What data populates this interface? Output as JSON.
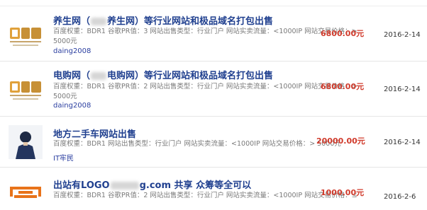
{
  "listings": [
    {
      "title_parts": [
        "养生网（",
        "养生网）等行业网站和极品域名打包出售"
      ],
      "detail_lines": [
        "百度权重：BDR1 谷歌PR值：3 网站出售类型：行业门户 网站实卖流量：<1000IP 网站交易价格：>",
        "5000元"
      ],
      "seller": "daing2008",
      "price": "6800.00元",
      "date": "2016-2-14",
      "thumb_icon": "domain-logo-icon"
    },
    {
      "title_parts": [
        "电购网（",
        "电购网）等行业网站和极品域名打包出售"
      ],
      "detail_lines": [
        "百度权重：BDR1 谷歌PR值：2 网站出售类型：行业门户 网站实卖流量：<1000IP 网站交易价格：>",
        "5000元"
      ],
      "seller": "daing2008",
      "price": "6800.00元",
      "date": "2016-2-14",
      "thumb_icon": "domain-logo-icon"
    },
    {
      "title_parts": [
        "地方二手车网站出售"
      ],
      "detail_lines": [
        "百度权重：BDR1 网站出售类型：行业门户 网站实卖流量：<1000IP 网站交易价格：> 5000元"
      ],
      "seller": "IT牢民",
      "price": "20000.00元",
      "date": "2016-2-14",
      "thumb_icon": "user-avatar-icon"
    },
    {
      "title_parts": [
        "出站有LOGO",
        "g.com 共享 众筹等全可以"
      ],
      "detail_lines": [
        "百度权重：BDR1 谷歌PR值：2 网站出售类型：行业门户 网站实卖流量：<1000IP 网站交易价格：≤"
      ],
      "seller": "",
      "price": "1000.00元",
      "date": "2016-2-6",
      "thumb_icon": "brand-logo-icon"
    }
  ],
  "colors": {
    "title": "#1f3f8f",
    "price": "#d03a2b",
    "seller": "#2b3fa0",
    "detail": "#7a7a7a",
    "logo_orange": "#e8731a"
  }
}
